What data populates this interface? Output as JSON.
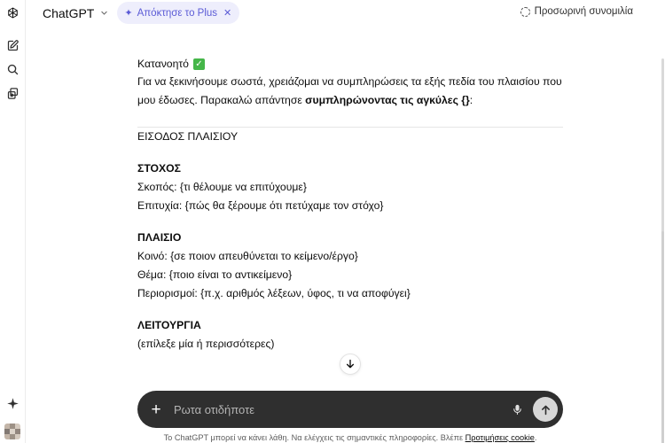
{
  "header": {
    "model_name": "ChatGPT",
    "upgrade_label": "Απόκτησε το Plus",
    "temporary_chat_label": "Προσωρινή συνομιλία"
  },
  "message": {
    "ack_text": "Κατανοητό",
    "intro_text": "Για να ξεκινήσουμε σωστά, χρειάζομαι να συμπληρώσεις τα εξής πεδία του πλαισίου που μου έδωσες. Παρακαλώ απάντησε ",
    "intro_bold": "συμπληρώνοντας τις αγκύλες {}",
    "intro_end": ":",
    "section_title": "ΕΙΣΟΔΟΣ ΠΛΑΙΣΙΟΥ",
    "blocks": [
      {
        "heading": "ΣΤΟΧΟΣ",
        "lines": [
          "Σκοπός: {τι θέλουμε να επιτύχουμε}",
          "Επιτυχία: {πώς θα ξέρουμε ότι πετύχαμε τον στόχο}"
        ]
      },
      {
        "heading": "ΠΛΑΙΣΙΟ",
        "lines": [
          "Κοινό: {σε ποιον απευθύνεται το κείμενο/έργο}",
          "Θέμα: {ποιο είναι το αντικείμενο}",
          "Περιορισμοί: {π.χ. αριθμός λέξεων, ύφος, τι να αποφύγει}"
        ]
      },
      {
        "heading": "ΛΕΙΤΟΥΡΓΙΑ",
        "lines": [
          "(επίλεξε μία ή περισσότερες)"
        ]
      }
    ]
  },
  "composer": {
    "placeholder": "Ρωτα οτιδήποτε"
  },
  "footer": {
    "disclaimer": "Το ChatGPT μπορεί να κάνει λάθη. Να ελέγχεις τις σημαντικές πληροφορίες. Βλέπε ",
    "cookie_link": "Προτιμήσεις cookie",
    "end": "."
  },
  "colors": {
    "accent": "#5b5bd6",
    "composer_bg": "#2f2f2f",
    "check_green": "#45b649"
  },
  "icons": {
    "logo": "openai-logo-icon",
    "new_chat": "new-chat-icon",
    "search": "search-icon",
    "library": "library-icon",
    "sparkle": "sparkle-icon"
  }
}
